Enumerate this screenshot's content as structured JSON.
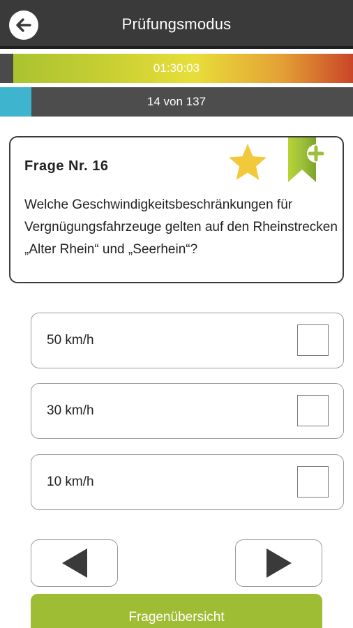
{
  "header": {
    "title": "Prüfungsmodus",
    "back_icon": "arrow-left-icon"
  },
  "timer": {
    "value": "01:30:03",
    "elapsed_fraction": 0.04
  },
  "progress": {
    "text": "14 von 137",
    "current": 14,
    "total": 137
  },
  "question": {
    "number_label": "Frage Nr. 16",
    "text": "Welche Geschwindigkeitsbeschränkungen für Vergnügungsfahrzeuge gelten auf den Rheinstrecken „Alter Rhein“ und „Seerhein“?",
    "star_icon": "star-icon",
    "bookmark_icon": "bookmark-add-icon"
  },
  "answers": [
    {
      "label": "50 km/h",
      "checked": false
    },
    {
      "label": "30 km/h",
      "checked": false
    },
    {
      "label": "10 km/h",
      "checked": false
    }
  ],
  "navigation": {
    "prev_icon": "triangle-left-icon",
    "next_icon": "triangle-right-icon",
    "overview_label": "Fragenübersicht"
  },
  "colors": {
    "appbar": "#3a3a3a",
    "accent_green": "#9fbd34",
    "progress_blue": "#3fb4cf",
    "star_yellow": "#f1c93b"
  }
}
